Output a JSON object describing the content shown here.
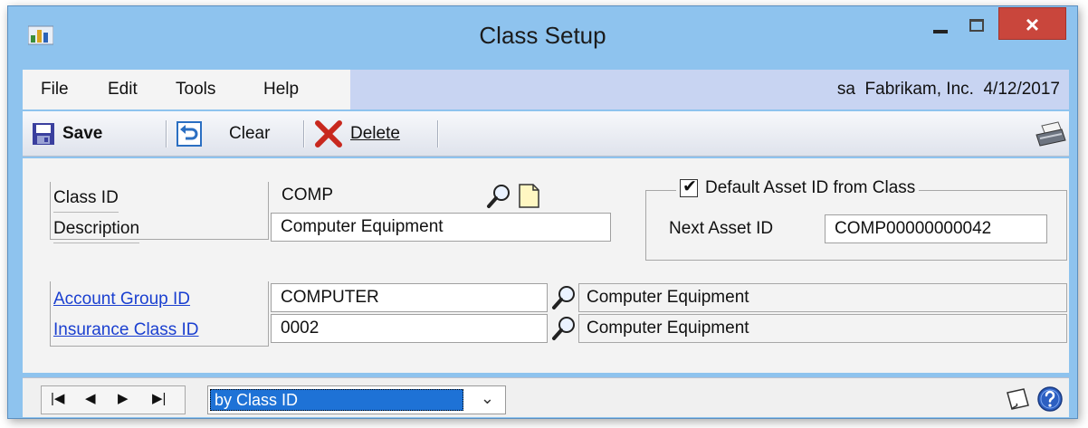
{
  "window": {
    "title": "Class Setup",
    "close_glyph": "×",
    "icons": {
      "app": "dynamics-app-icon",
      "minimize": "minimize-icon",
      "maximize": "maximize-icon",
      "close": "close-icon"
    }
  },
  "menu": {
    "items": [
      "File",
      "Edit",
      "Tools",
      "Help"
    ],
    "user_info": "sa  Fabrikam, Inc.  4/12/2017"
  },
  "toolbar": {
    "save_label": "Save",
    "clear_label": "Clear",
    "delete_label": "Delete",
    "icons": {
      "save": "save-icon",
      "clear": "clear-icon",
      "delete": "delete-x-icon",
      "print": "printer-icon"
    }
  },
  "form": {
    "class_id": {
      "label": "Class ID",
      "value": "COMP"
    },
    "description": {
      "label": "Description",
      "value": "Computer Equipment"
    },
    "default_asset": {
      "label": "Default Asset ID from Class",
      "checked": true
    },
    "next_asset_id": {
      "label": "Next Asset ID",
      "value": "COMP00000000042"
    },
    "account_group": {
      "label": "Account Group ID",
      "value": "COMPUTER",
      "description": "Computer Equipment"
    },
    "insurance_class": {
      "label": "Insurance Class ID",
      "value": "0002",
      "description": "Computer Equipment"
    },
    "check_glyph": "✔"
  },
  "statusbar": {
    "nav": [
      "|◀",
      "◀",
      "▶",
      "▶|"
    ],
    "sort_value": "by Class ID",
    "sort_chevron": "⌄",
    "icons": {
      "note": "note-icon",
      "help": "help-icon"
    }
  },
  "colors": {
    "title_bar": "#8ec3ee",
    "close_button": "#c9463c",
    "link": "#1a3fd0",
    "selection": "#1e72d6",
    "menu_right": "#c8d4f2"
  }
}
